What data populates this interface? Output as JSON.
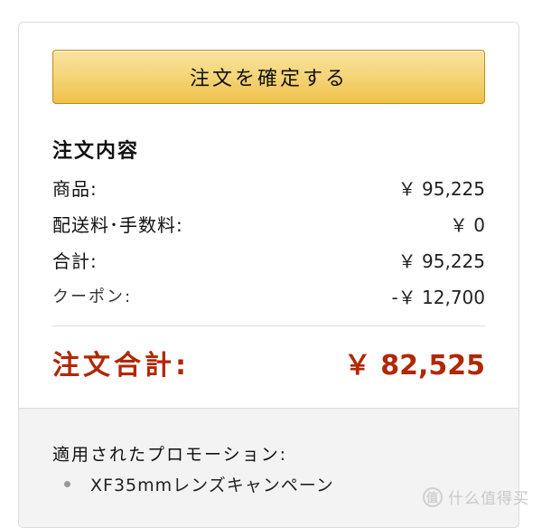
{
  "confirm_button": {
    "label": "注文を確定する"
  },
  "order_summary": {
    "title": "注文内容",
    "rows": [
      {
        "label": "商品:",
        "value": "￥ 95,225"
      },
      {
        "label": "配送料･手数料:",
        "value": "￥ 0"
      },
      {
        "label": "合計:",
        "value": "￥ 95,225"
      },
      {
        "label": "クーポン:",
        "value": "-￥ 12,700"
      }
    ],
    "total": {
      "label": "注文合計:",
      "value": "￥ 82,525"
    }
  },
  "promotions": {
    "title": "適用されたプロモーション:",
    "items": [
      "XF35mmレンズキャンペーン"
    ]
  },
  "watermark": {
    "text": "什么值得买",
    "icon": "zhide-logo-icon"
  },
  "colors": {
    "button_top": "#f9e3a0",
    "button_bottom": "#eec14b",
    "total_red": "#b12704",
    "promo_bg": "#f3f3f3"
  }
}
